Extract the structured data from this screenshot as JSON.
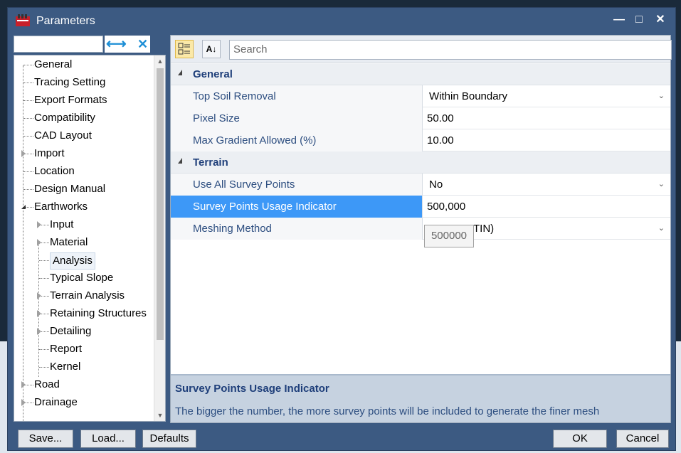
{
  "window": {
    "title": "Parameters"
  },
  "left_panel": {
    "search_value": "",
    "swap_glyph": "⟷",
    "clear_glyph": "✕",
    "tree": [
      {
        "label": "General",
        "level": 0,
        "expander": "none"
      },
      {
        "label": "Tracing Setting",
        "level": 0,
        "expander": "none"
      },
      {
        "label": "Export Formats",
        "level": 0,
        "expander": "none"
      },
      {
        "label": "Compatibility",
        "level": 0,
        "expander": "none"
      },
      {
        "label": "CAD Layout",
        "level": 0,
        "expander": "none"
      },
      {
        "label": "Import",
        "level": 0,
        "expander": "closed"
      },
      {
        "label": "Location",
        "level": 0,
        "expander": "none"
      },
      {
        "label": "Design Manual",
        "level": 0,
        "expander": "none"
      },
      {
        "label": "Earthworks",
        "level": 0,
        "expander": "open"
      },
      {
        "label": "Input",
        "level": 1,
        "expander": "closed"
      },
      {
        "label": "Material",
        "level": 1,
        "expander": "closed"
      },
      {
        "label": "Analysis",
        "level": 1,
        "expander": "none",
        "selected": true
      },
      {
        "label": "Typical Slope",
        "level": 1,
        "expander": "none"
      },
      {
        "label": "Terrain Analysis",
        "level": 1,
        "expander": "closed"
      },
      {
        "label": "Retaining Structures",
        "level": 1,
        "expander": "closed"
      },
      {
        "label": "Detailing",
        "level": 1,
        "expander": "closed"
      },
      {
        "label": "Report",
        "level": 1,
        "expander": "none"
      },
      {
        "label": "Kernel",
        "level": 1,
        "expander": "none"
      },
      {
        "label": "Road",
        "level": 0,
        "expander": "closed"
      },
      {
        "label": "Drainage",
        "level": 0,
        "expander": "closed"
      }
    ]
  },
  "toolbar": {
    "search_placeholder": "Search",
    "sort_glyph": "A↓"
  },
  "grid": {
    "categories": [
      {
        "label": "General",
        "rows": [
          {
            "name": "Top Soil Removal",
            "value": "Within Boundary",
            "dropdown": true
          },
          {
            "name": "Pixel Size",
            "value": "50.00",
            "dropdown": false
          },
          {
            "name": "Max Gradient Allowed (%)",
            "value": "10.00",
            "dropdown": false
          }
        ]
      },
      {
        "label": "Terrain",
        "rows": [
          {
            "name": "Use All Survey Points",
            "value": "No",
            "dropdown": true
          },
          {
            "name": "Survey Points Usage Indicator",
            "value": "500,000",
            "dropdown": false,
            "selected": true
          },
          {
            "name": "Meshing Method",
            "value": "TIN)",
            "dropdown": true
          }
        ]
      }
    ],
    "tooltip": "500000"
  },
  "description": {
    "title": "Survey Points Usage Indicator",
    "text": "The bigger the number, the more survey points will be included to generate the finer mesh"
  },
  "footer": {
    "save": "Save...",
    "load": "Load...",
    "defaults": "Defaults",
    "ok": "OK",
    "cancel": "Cancel"
  },
  "colors": {
    "title_bar": "#3c5a82",
    "selection": "#3d98f7",
    "category_text": "#1f3f7a"
  }
}
